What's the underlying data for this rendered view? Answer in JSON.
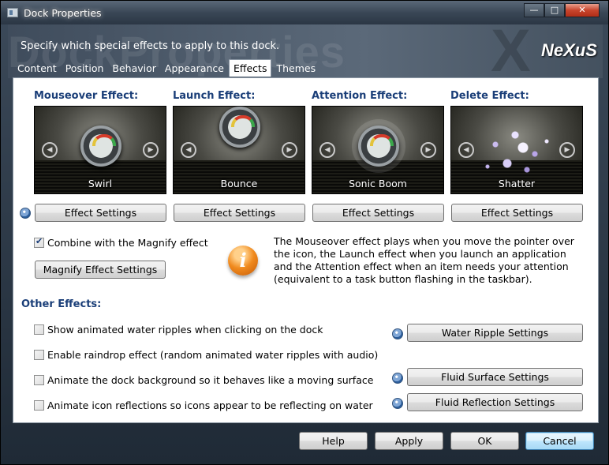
{
  "window": {
    "title": "Dock Properties",
    "minimize_glyph": "—",
    "maximize_glyph": "□",
    "close_glyph": "✕"
  },
  "banner": {
    "subtitle": "Specify which special effects to apply to this dock.",
    "watermark": "DockProperties",
    "logo": "NeXuS"
  },
  "tabs": [
    {
      "label": "Content"
    },
    {
      "label": "Position"
    },
    {
      "label": "Behavior"
    },
    {
      "label": "Appearance"
    },
    {
      "label": "Effects",
      "active": true
    },
    {
      "label": "Themes"
    }
  ],
  "effects": [
    {
      "heading": "Mouseover Effect:",
      "caption": "Swirl",
      "button": "Effect Settings"
    },
    {
      "heading": "Launch Effect:",
      "caption": "Bounce",
      "button": "Effect Settings"
    },
    {
      "heading": "Attention Effect:",
      "caption": "Sonic Boom",
      "button": "Effect Settings"
    },
    {
      "heading": "Delete Effect:",
      "caption": "Shatter",
      "button": "Effect Settings"
    }
  ],
  "arrows": {
    "left": "◀",
    "right": "▶"
  },
  "magnify": {
    "checkbox_label": "Combine with the Magnify effect",
    "checked": true,
    "button": "Magnify Effect Settings"
  },
  "info": {
    "icon_glyph": "i",
    "text": "The Mouseover effect plays when you move the pointer over the icon, the Launch effect when you launch an application and the Attention effect when an item needs your attention (equivalent to a task button flashing in the taskbar)."
  },
  "other_effects": {
    "heading": "Other Effects:",
    "options": [
      {
        "label": "Show animated water ripples when clicking on the dock",
        "checked": false
      },
      {
        "label": "Enable raindrop effect (random animated water ripples with audio)",
        "checked": false
      },
      {
        "label": "Animate the dock background so it behaves like a moving surface",
        "checked": false
      },
      {
        "label": "Animate icon reflections so icons appear to be reflecting on water",
        "checked": false
      }
    ],
    "water_ripple_button": "Water Ripple Settings",
    "fluid_surface_button": "Fluid Surface Settings",
    "fluid_reflection_button": "Fluid Reflection Settings"
  },
  "footer": {
    "help": "Help",
    "apply": "Apply",
    "ok": "OK",
    "cancel": "Cancel"
  }
}
